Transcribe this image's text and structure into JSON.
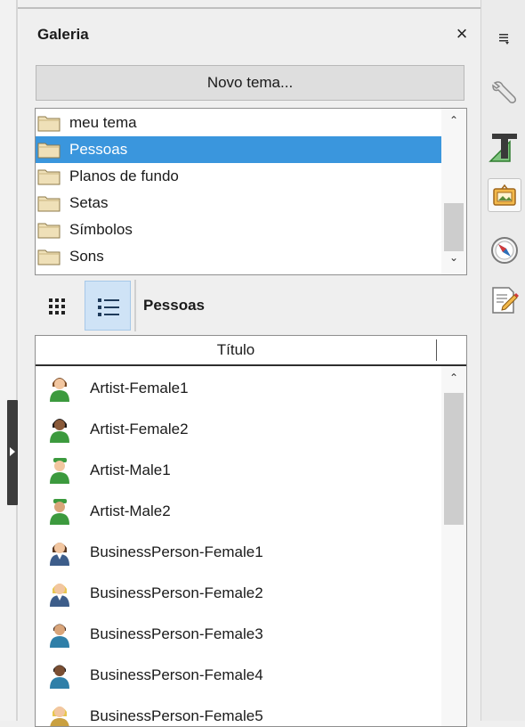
{
  "panel": {
    "title": "Galeria",
    "close_glyph": "×",
    "new_theme_label": "Novo tema..."
  },
  "themes": [
    {
      "label": "meu tema",
      "selected": false
    },
    {
      "label": "Pessoas",
      "selected": true
    },
    {
      "label": "Planos de fundo",
      "selected": false
    },
    {
      "label": "Setas",
      "selected": false
    },
    {
      "label": "Símbolos",
      "selected": false
    },
    {
      "label": "Sons",
      "selected": false
    }
  ],
  "view": {
    "icon_view_icon": "grid-icon",
    "detail_view_icon": "list-icon",
    "active_view": "detail",
    "current_theme": "Pessoas"
  },
  "items_list": {
    "column_title": "Título",
    "items": [
      {
        "label": "Artist-Female1",
        "icon": "artist-female-avatar"
      },
      {
        "label": "Artist-Female2",
        "icon": "artist-female-avatar"
      },
      {
        "label": "Artist-Male1",
        "icon": "artist-male-avatar"
      },
      {
        "label": "Artist-Male2",
        "icon": "artist-male-avatar"
      },
      {
        "label": "BusinessPerson-Female1",
        "icon": "business-female-avatar"
      },
      {
        "label": "BusinessPerson-Female2",
        "icon": "business-female-avatar"
      },
      {
        "label": "BusinessPerson-Female3",
        "icon": "business-female-avatar"
      },
      {
        "label": "BusinessPerson-Female4",
        "icon": "business-female-avatar"
      },
      {
        "label": "BusinessPerson-Female5",
        "icon": "business-female-avatar"
      }
    ]
  },
  "deck": {
    "menu_icon": "sidebar-menu-icon",
    "items": [
      {
        "icon": "properties-wrench-icon",
        "active": false
      },
      {
        "icon": "styles-icon",
        "active": false
      },
      {
        "icon": "gallery-icon",
        "active": true
      },
      {
        "icon": "navigator-icon",
        "active": false
      },
      {
        "icon": "page-edit-icon",
        "active": false
      }
    ]
  },
  "colors": {
    "selection": "#3a96dd",
    "active_view_bg": "#cfe3f6"
  }
}
